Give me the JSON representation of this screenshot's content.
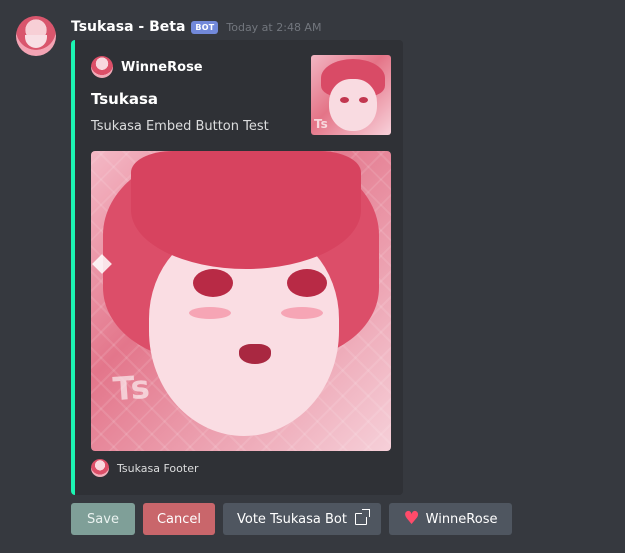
{
  "message": {
    "username": "Tsukasa - Beta",
    "bot_tag": "BOT",
    "timestamp": "Today at 2:48 AM"
  },
  "embed": {
    "accent_color": "#1cf5b3",
    "author": "WinneRose",
    "title": "Tsukasa",
    "description": "Tsukasa Embed Button Test",
    "thumbnail_watermark": "Ts",
    "image_watermark": "Ts",
    "footer": "Tsukasa Footer"
  },
  "buttons": [
    {
      "label": "Save",
      "style": "success"
    },
    {
      "label": "Cancel",
      "style": "danger"
    },
    {
      "label": "Vote Tsukasa Bot",
      "style": "link",
      "icon": "external-link-icon"
    },
    {
      "label": "WinneRose",
      "style": "secondary",
      "icon": "heart-icon"
    }
  ]
}
